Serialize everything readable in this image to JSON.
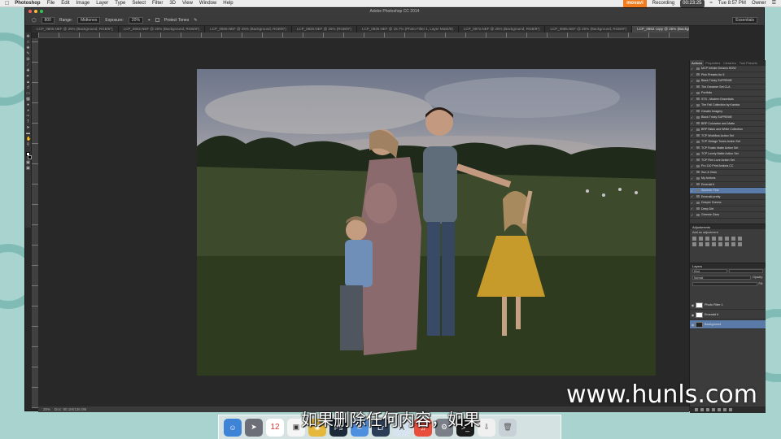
{
  "menubar": {
    "app_name": "Photoshop",
    "items": [
      "File",
      "Edit",
      "Image",
      "Layer",
      "Type",
      "Select",
      "Filter",
      "3D",
      "View",
      "Window",
      "Help"
    ],
    "recorder_brand": "movavi",
    "recording_label": "Recording",
    "recording_time": "00:23:25",
    "clock": "Tue 8:57 PM",
    "user": "Owner"
  },
  "window": {
    "title": "Adobe Photoshop CC 2014"
  },
  "options_bar": {
    "brush_size": "800",
    "range_label": "Range:",
    "range_value": "Midtones",
    "exposure_label": "Exposure:",
    "exposure_value": "20%",
    "protect_tones_label": "Protect Tones",
    "essentials": "Essentials"
  },
  "tabs": [
    "LCP_0800.NEF @ 25% (Background, RGB/8*)",
    "LCP_0802.NEF @ 25% (Background, RGB/8*)",
    "LCP_0808.NEF @ 25% (Background, RGB/8*)",
    "LCP_0820.NEF @ 25% (RGB/8*)",
    "LCP_0830.NEF @ 16.7% (Photo Filter 1, Layer Mask/8)",
    "LCP_0872.NEF @ 25% (Background, RGB/8*)",
    "LCP_0885.NEF @ 25% (Background, RGB/8*)",
    "LCP_0862 copy @ 25% (Background, RGB/8*)"
  ],
  "status": {
    "zoom": "25%",
    "doc_info": "Doc: 80.1M/136.0M"
  },
  "actions_panel": {
    "tabs": [
      "Actions",
      "Properties",
      "Libraries",
      "Tool Presets"
    ],
    "rows": [
      {
        "label": "MCP Infinite Dreams BOW",
        "selected": false
      },
      {
        "label": "Pink Presets for 5",
        "selected": false
      },
      {
        "label": "Black Tricky SUPREME",
        "selected": false
      },
      {
        "label": "The Dreamer Set CLA",
        "selected": false
      },
      {
        "label": "Portfolio",
        "selected": false
      },
      {
        "label": "STS - Modern Essentials",
        "selected": false
      },
      {
        "label": "The Fall Collection by Kamba",
        "selected": false
      },
      {
        "label": "Greater Imagery",
        "selected": false
      },
      {
        "label": "Black Tricky SUPREME",
        "selected": false
      },
      {
        "label": "BRP Colorwise and Matte",
        "selected": false
      },
      {
        "label": "BRP Black and White Collection",
        "selected": false
      },
      {
        "label": "TCP Workflow Action Set",
        "selected": false
      },
      {
        "label": "TCP Vintage Tones Action Set",
        "selected": false
      },
      {
        "label": "TCP Rustic Matte Action Set",
        "selected": false
      },
      {
        "label": "TCP Lovely Matte Action Set",
        "selected": false
      },
      {
        "label": "TCP Film Love Action Set",
        "selected": false
      },
      {
        "label": "Pro 110 Print Actions CC",
        "selected": false
      },
      {
        "label": "Sun & Glow",
        "selected": false
      },
      {
        "label": "My Actions",
        "selected": false
      },
      {
        "label": "Emerald it",
        "selected": false
      },
      {
        "label": "Summer Fine",
        "selected": true
      },
      {
        "label": "Emerald pretty",
        "selected": false
      },
      {
        "label": "Deeper Greens",
        "selected": false
      },
      {
        "label": "Deep Dirt",
        "selected": false
      },
      {
        "label": "Greenie Glow",
        "selected": false
      }
    ]
  },
  "adjustments_panel": {
    "title": "Adjustments",
    "subtitle": "Add an adjustment"
  },
  "layers_panel": {
    "title": "Layers",
    "kind": "Kind",
    "blend": "Normal",
    "opacity": "Opacity:",
    "fill": "Fill:",
    "rows": [
      {
        "name": "Photo Filter 1",
        "thumb": "white",
        "selected": false
      },
      {
        "name": "Emerald it",
        "thumb": "white",
        "selected": false
      },
      {
        "name": "Background",
        "thumb": "photo",
        "selected": true
      }
    ]
  },
  "overlay": {
    "subtitle": "如果删除任何内容，如果",
    "watermark": "www.hunls.com"
  },
  "colors": {
    "desktop": "#a9d3ce",
    "selection": "#5a7ba8",
    "recorder": "#f07c1d"
  }
}
